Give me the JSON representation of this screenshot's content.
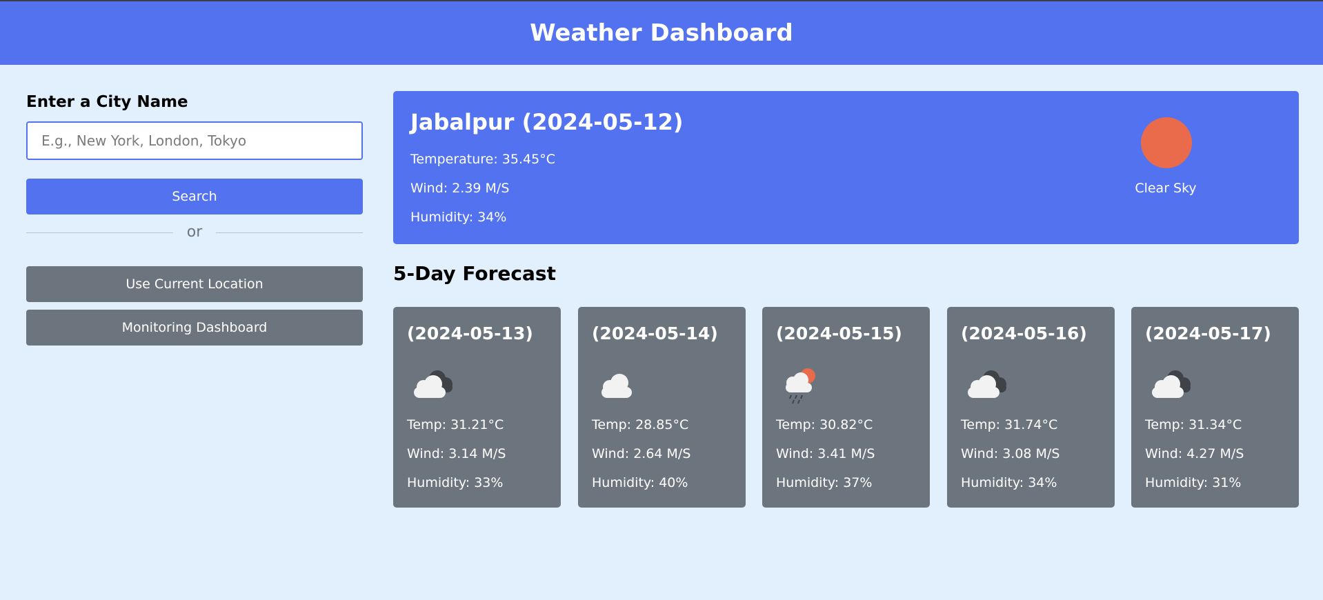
{
  "header": {
    "title": "Weather Dashboard"
  },
  "search": {
    "label": "Enter a City Name",
    "input_value": "",
    "placeholder": "E.g., New York, London, Tokyo",
    "search_label": "Search",
    "separator_text": "or",
    "location_label": "Use Current Location",
    "monitor_label": "Monitoring Dashboard"
  },
  "current": {
    "title": "Jabalpur (2024-05-12)",
    "temperature": "Temperature: 35.45°C",
    "wind": "Wind: 2.39 M/S",
    "humidity": "Humidity: 34%",
    "icon": "clear-sky-sun-icon",
    "description": "Clear Sky"
  },
  "forecast": {
    "title": "5-Day Forecast",
    "days": [
      {
        "date": "(2024-05-13)",
        "icon": "broken-clouds-icon",
        "temp": "Temp: 31.21°C",
        "wind": "Wind: 3.14 M/S",
        "humidity": "Humidity: 33%"
      },
      {
        "date": "(2024-05-14)",
        "icon": "cloud-icon",
        "temp": "Temp: 28.85°C",
        "wind": "Wind: 2.64 M/S",
        "humidity": "Humidity: 40%"
      },
      {
        "date": "(2024-05-15)",
        "icon": "light-rain-sun-icon",
        "temp": "Temp: 30.82°C",
        "wind": "Wind: 3.41 M/S",
        "humidity": "Humidity: 37%"
      },
      {
        "date": "(2024-05-16)",
        "icon": "broken-clouds-icon",
        "temp": "Temp: 31.74°C",
        "wind": "Wind: 3.08 M/S",
        "humidity": "Humidity: 34%"
      },
      {
        "date": "(2024-05-17)",
        "icon": "broken-clouds-icon",
        "temp": "Temp: 31.34°C",
        "wind": "Wind: 4.27 M/S",
        "humidity": "Humidity: 31%"
      }
    ]
  },
  "colors": {
    "primary": "#5372f0",
    "secondary": "#6c757d",
    "background": "#e2f0fd",
    "sun": "#e96b4c"
  }
}
